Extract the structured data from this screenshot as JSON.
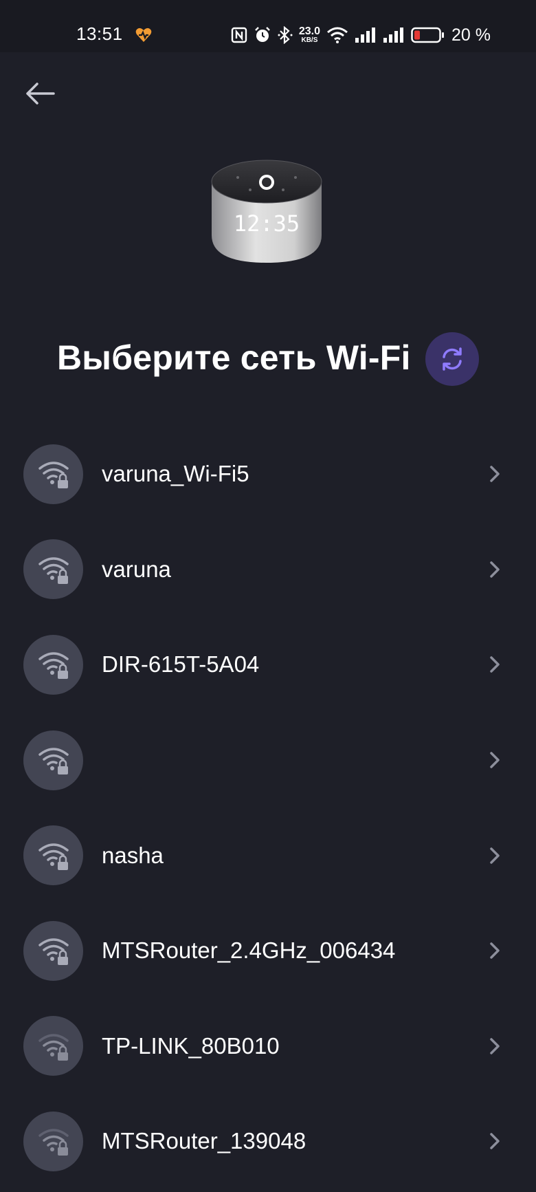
{
  "status_bar": {
    "time": "13:51",
    "net_speed_value": "23.0",
    "net_speed_unit": "KB/S",
    "battery_percent": "20 %",
    "icons": [
      "health-app-icon",
      "nfc-icon",
      "alarm-icon",
      "bluetooth-icon",
      "wifi-status-icon",
      "signal-icon",
      "signal-icon",
      "battery-icon"
    ],
    "battery_color": "#e53935"
  },
  "header": {
    "back_icon": "arrow-left-icon",
    "device_image": "smart-speaker-clock",
    "device_clock_text": "12:35"
  },
  "title": "Выберите сеть Wi-Fi",
  "refresh_icon": "refresh-icon",
  "colors": {
    "background": "#1e1f28",
    "accent": "#8f7bff",
    "refresh_bg": "#3a3268",
    "item_circle": "#434553"
  },
  "networks": [
    {
      "name": "varuna_Wi-Fi5",
      "signal": 3,
      "locked": true
    },
    {
      "name": "varuna",
      "signal": 3,
      "locked": true
    },
    {
      "name": "DIR-615T-5A04",
      "signal": 3,
      "locked": true
    },
    {
      "name": "",
      "signal": 3,
      "locked": true
    },
    {
      "name": "nasha",
      "signal": 3,
      "locked": true
    },
    {
      "name": "MTSRouter_2.4GHz_006434",
      "signal": 3,
      "locked": true
    },
    {
      "name": "TP-LINK_80B010",
      "signal": 2,
      "locked": true
    },
    {
      "name": "MTSRouter_139048",
      "signal": 2,
      "locked": true
    }
  ]
}
